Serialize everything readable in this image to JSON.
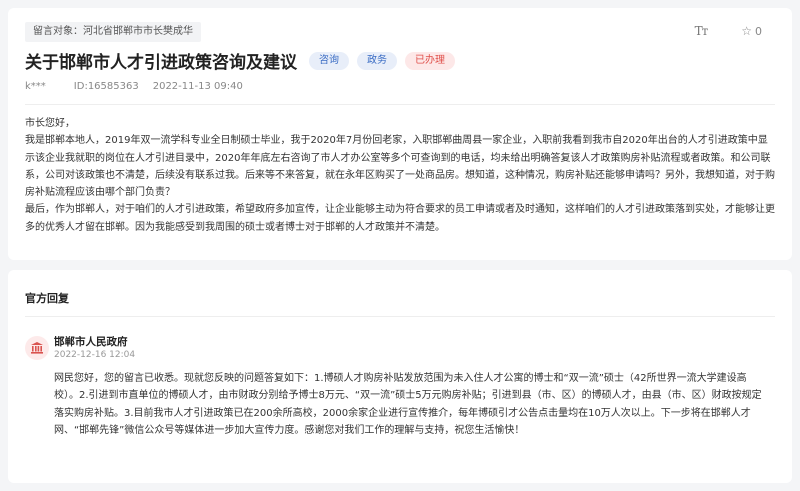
{
  "message": {
    "target_tag": "留言对象：河北省邯郸市市长樊成华",
    "font_size_label": "Tт",
    "favorite_count": "0",
    "title": "关于邯郸市人才引进政策咨询及建议",
    "badges": [
      "咨询",
      "政务",
      "已办理"
    ],
    "author": "k***",
    "id": "ID:16585363",
    "datetime": "2022-11-13 09:40",
    "paragraphs": [
      "市长您好，",
      "我是邯郸本地人，2019年双一流学科专业全日制硕士毕业，我于2020年7月份回老家，入职邯郸曲周县一家企业，入职前我看到我市自2020年出台的人才引进政策中显示该企业我就职的岗位在人才引进目录中，2020年年底左右咨询了市人才办公室等多个可查询到的电话，均未给出明确答复该人才政策购房补贴流程或者政策。和公司联系，公司对该政策也不清楚，后续没有联系过我。后来等不来答复，就在永年区购买了一处商品房。想知道，这种情况，购房补贴还能够申请吗？另外，我想知道，对于购房补贴流程应该由哪个部门负责？",
      "最后，作为邯郸人，对于咱们的人才引进政策，希望政府多加宣传，让企业能够主动为符合要求的员工申请或者及时通知，这样咱们的人才引进政策落到实处，才能够让更多的优秀人才留在邯郸。因为我能感受到我周围的硕士或者博士对于邯郸的人才政策并不清楚。"
    ]
  },
  "reply": {
    "heading": "官方回复",
    "org_name": "邯郸市人民政府",
    "datetime": "2022-12-16 12:04",
    "text": "网民您好，您的留言已收悉。现就您反映的问题答复如下：1.博硕人才购房补贴发放范围为未入住人才公寓的博士和“双一流”硕士（42所世界一流大学建设高校）。2.引进到市直单位的博硕人才，由市财政分别给予博士8万元、“双一流”硕士5万元购房补贴；引进到县（市、区）的博硕人才，由县（市、区）财政按规定落实购房补贴。3.目前我市人才引进政策已在200余所高校，2000余家企业进行宣传推介，每年博硕引才公告点击量均在10万人次以上。下一步将在邯郸人才网、“邯郸先锋”微信公众号等媒体进一步加大宣传力度。感谢您对我们工作的理解与支持，祝您生活愉快！"
  },
  "colors": {
    "badge_blue": "#3a6cc4",
    "badge_red": "#e0504b",
    "gov_icon": "#d9534f"
  }
}
